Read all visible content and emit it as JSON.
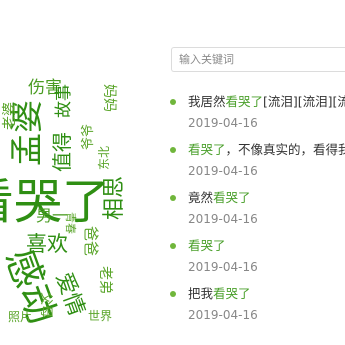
{
  "cloud": {
    "words": [
      "伤害",
      "故事",
      "妈妈",
      "爷爷",
      "孟婆",
      "值得",
      "青春",
      "看哭了",
      "相思",
      "世界",
      "男一",
      "喜欢",
      "爸爸",
      "感动",
      "父母",
      "爱情",
      "照片",
      "老弟",
      "老婆",
      "东北"
    ]
  },
  "search": {
    "placeholder": "输入关键词"
  },
  "list": [
    {
      "pre": "我居然",
      "hl": "看哭了",
      "post": "[流泪][流泪][流泪]",
      "date": "2019-04-16"
    },
    {
      "pre": "",
      "hl": "看哭了",
      "post": "，不像真实的，看得我好感动",
      "date": "2019-04-16"
    },
    {
      "pre": "竟然",
      "hl": "看哭了",
      "post": "",
      "date": "2019-04-16"
    },
    {
      "pre": "",
      "hl": "看哭了",
      "post": "",
      "date": "2019-04-16"
    },
    {
      "pre": "把我",
      "hl": "看哭了",
      "post": "",
      "date": "2019-04-16"
    }
  ],
  "colors": {
    "accent": "#5aa52a",
    "dot": "#70b63b",
    "date": "#888888"
  }
}
